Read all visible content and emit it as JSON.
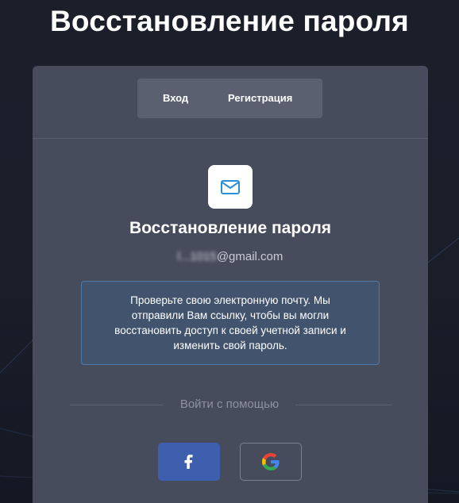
{
  "page": {
    "title": "Восстановление пароля"
  },
  "tabs": [
    {
      "label": "Вход"
    },
    {
      "label": "Регистрация"
    }
  ],
  "card": {
    "icon": "mail-icon",
    "title": "Восстановление пароля",
    "email_masked": "l...1015",
    "email_domain": "@gmail.com",
    "message": "Проверьте свою электронную почту. Мы отправили Вам ссылку, чтобы вы могли восстановить доступ к своей учетной записи и изменить свой пароль.",
    "social_label": "Войти с помощью",
    "social_buttons": [
      {
        "icon": "facebook-icon",
        "color": "#3d5fae"
      },
      {
        "icon": "google-icon"
      }
    ]
  },
  "colors": {
    "accent": "#3d5fae",
    "mail_icon": "#2b8fd6",
    "info_bg": "#41536d",
    "info_border": "#4f79a8"
  }
}
